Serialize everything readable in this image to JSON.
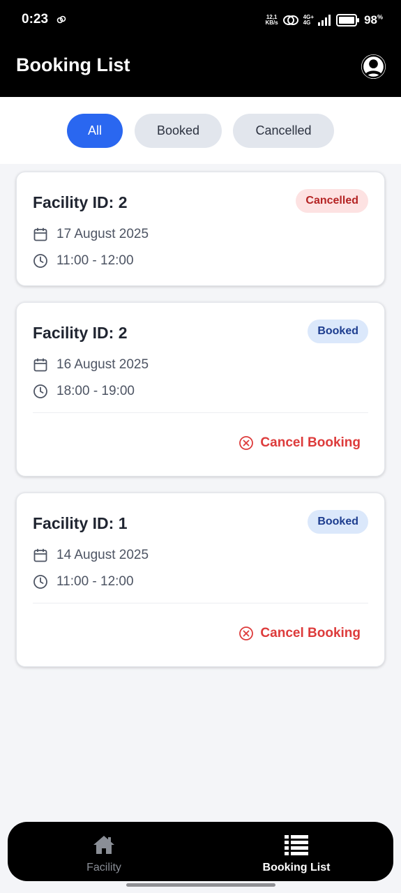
{
  "status_bar": {
    "time": "0:23",
    "speed_top": "12,1",
    "speed_bottom": "KB/s",
    "network_top": "4G+",
    "network_bottom": "4G",
    "battery": "98",
    "battery_unit": "%"
  },
  "app_bar": {
    "title": "Booking List",
    "profile_icon": "account-circle-icon"
  },
  "filters": {
    "all": "All",
    "booked": "Booked",
    "cancelled": "Cancelled",
    "selected": "All"
  },
  "bookings": [
    {
      "title": "Facility ID: 2",
      "status": "Cancelled",
      "date": "17 August 2025",
      "time": "11:00 - 12:00"
    },
    {
      "title": "Facility ID: 2",
      "status": "Booked",
      "date": "16 August 2025",
      "time": "18:00 - 19:00",
      "action": "Cancel Booking"
    },
    {
      "title": "Facility ID: 1",
      "status": "Booked",
      "date": "14 August 2025",
      "time": "11:00 - 12:00",
      "action": "Cancel Booking"
    }
  ],
  "bottom_nav": {
    "facility": "Facility",
    "booking_list": "Booking List",
    "active": "Booking List"
  },
  "colors": {
    "accent": "#2a67f0",
    "cancelled_badge_bg": "#fde2e2",
    "cancelled_badge_text": "#b42323",
    "booked_badge_bg": "#dbe8fb",
    "booked_badge_text": "#1d3d8f",
    "cancel_action": "#dd3b3b"
  }
}
